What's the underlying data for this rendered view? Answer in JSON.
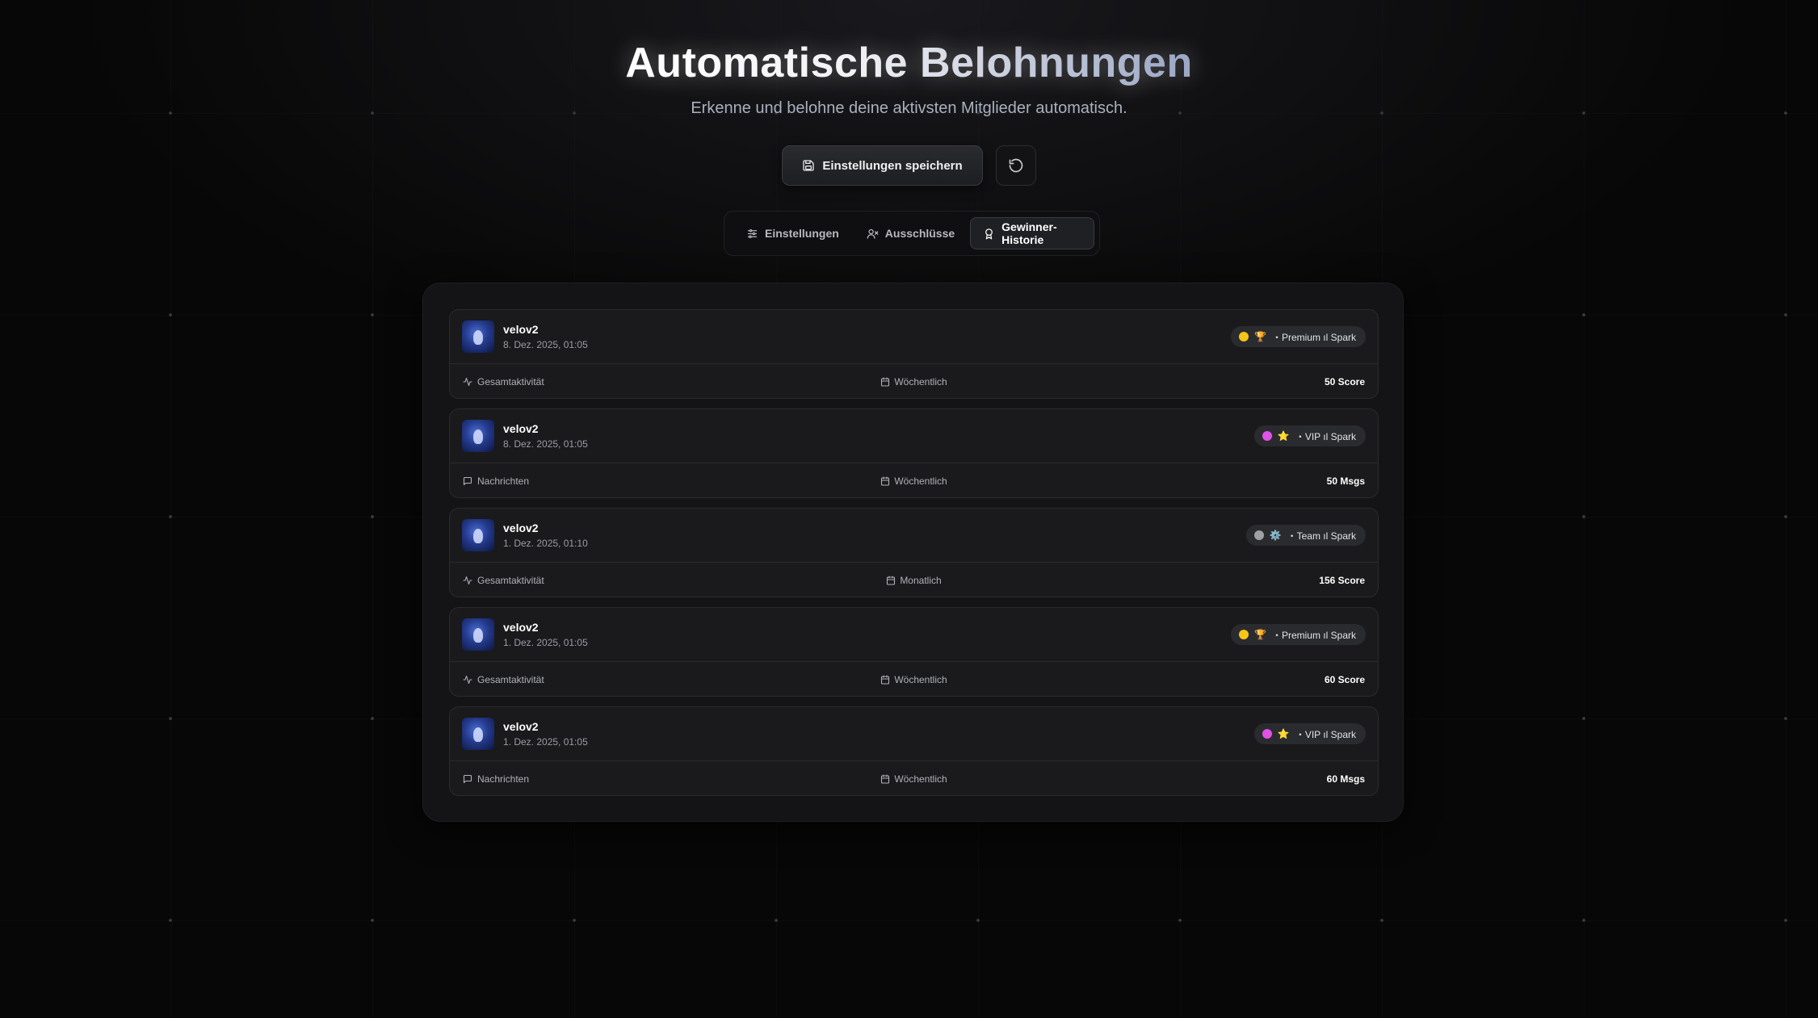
{
  "header": {
    "title": "Automatische Belohnungen",
    "subtitle": "Erkenne und belohne deine aktivsten Mitglieder automatisch."
  },
  "actions": {
    "save_label": "Einstellungen speichern",
    "save_icon": "save-icon",
    "reset_icon": "reset-icon"
  },
  "tabs": [
    {
      "label": "Einstellungen",
      "icon": "sliders-icon",
      "active": false
    },
    {
      "label": "Ausschlüsse",
      "icon": "user-exclude-icon",
      "active": false
    },
    {
      "label": "Gewinner-Historie",
      "icon": "award-icon",
      "active": true
    }
  ],
  "entries": [
    {
      "user": "velov2",
      "date": "8. Dez. 2025, 01:05",
      "badge_emoji": "🏆",
      "badge_label": "・Premium ıl Spark",
      "dot_color": "#f5c518",
      "metric": "Gesamtaktivität",
      "metric_icon": "activity-icon",
      "period": "Wöchentlich",
      "score": "50 Score"
    },
    {
      "user": "velov2",
      "date": "8. Dez. 2025, 01:05",
      "badge_emoji": "⭐",
      "badge_label": "・VIP ıl Spark",
      "dot_color": "#e052e6",
      "metric": "Nachrichten",
      "metric_icon": "message-icon",
      "period": "Wöchentlich",
      "score": "50 Msgs"
    },
    {
      "user": "velov2",
      "date": "1. Dez. 2025, 01:10",
      "badge_emoji": "⚙️",
      "badge_label": "・Team ıl Spark",
      "dot_color": "#a0a0a4",
      "metric": "Gesamtaktivität",
      "metric_icon": "activity-icon",
      "period": "Monatlich",
      "score": "156 Score"
    },
    {
      "user": "velov2",
      "date": "1. Dez. 2025, 01:05",
      "badge_emoji": "🏆",
      "badge_label": "・Premium ıl Spark",
      "dot_color": "#f5c518",
      "metric": "Gesamtaktivität",
      "metric_icon": "activity-icon",
      "period": "Wöchentlich",
      "score": "60 Score"
    },
    {
      "user": "velov2",
      "date": "1. Dez. 2025, 01:05",
      "badge_emoji": "⭐",
      "badge_label": "・VIP ıl Spark",
      "dot_color": "#e052e6",
      "metric": "Nachrichten",
      "metric_icon": "message-icon",
      "period": "Wöchentlich",
      "score": "60 Msgs"
    }
  ]
}
